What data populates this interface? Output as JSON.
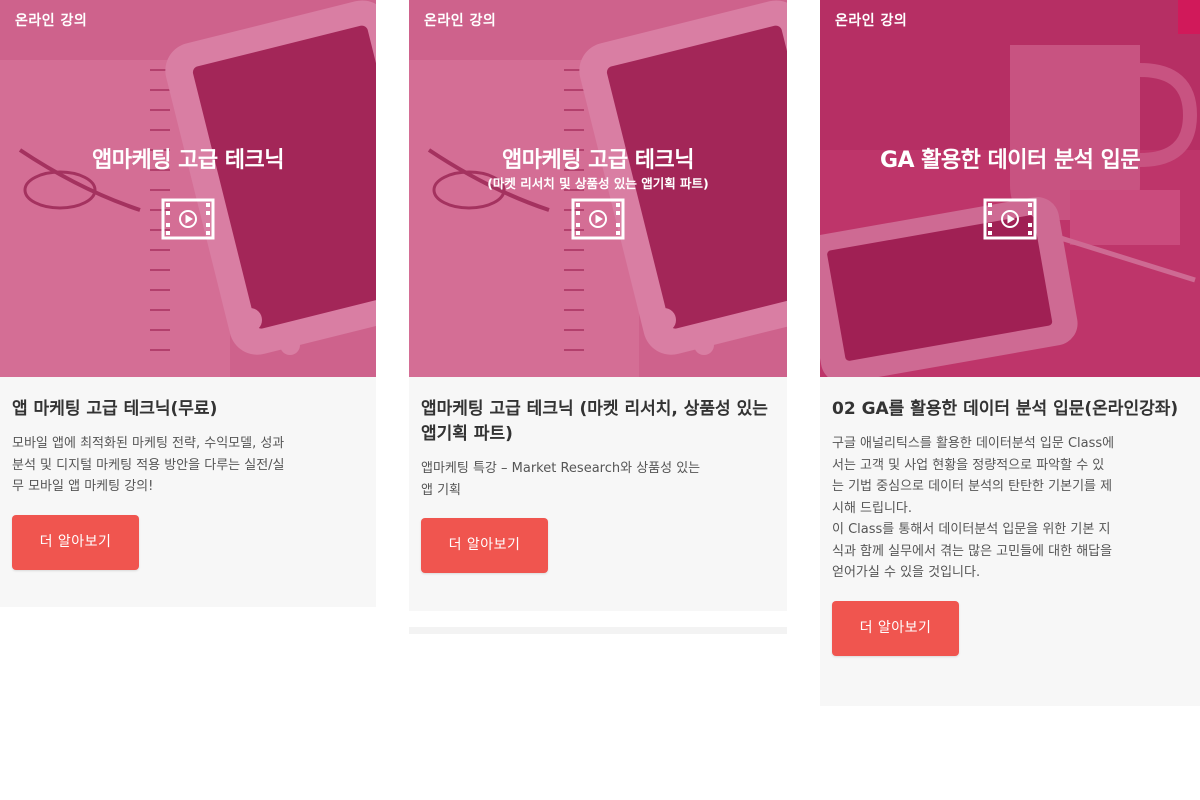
{
  "colors": {
    "accent": "#f0554f",
    "overlay": "#c4346e",
    "card_bg": "#f7f7f7"
  },
  "cards": [
    {
      "badge": "온라인 강의",
      "thumb_title": "앱마케팅 고급 테크닉",
      "title": "앱 마케팅 고급 테크닉(무료)",
      "description": [
        "모바일 앱에 최적화된 마케팅 전략, 수익모델, 성과",
        "분석 및 디지털 마케팅 적용 방안을 다루는 실전/실",
        "무 모바일 앱 마케팅 강의!"
      ],
      "button": "더 알아보기",
      "icon": "film-play-icon"
    },
    {
      "badge": "온라인 강의",
      "thumb_title": "앱마케팅 고급 테크닉",
      "thumb_subtitle": "(마켓 리서치 및 상품성 있는 앱기획 파트)",
      "title": "앱마케팅 고급 테크닉 (마켓 리서치, 상품성 있는 앱기획 파트)",
      "description": [
        "앱마케팅 특강 – Market Research와 상품성 있는",
        "앱 기획"
      ],
      "button": "더 알아보기",
      "icon": "film-play-icon"
    },
    {
      "badge": "온라인 강의",
      "thumb_title": "GA 활용한 데이터 분석 입문",
      "title": "02 GA를 활용한 데이터 분석 입문(온라인강좌)",
      "description": [
        "구글 애널리틱스를 활용한 데이터분석 입문 Class에",
        "서는 고객 및 사업 현황을 정량적으로 파악할 수 있",
        "는 기법 중심으로 데이터 분석의 탄탄한 기본기를 제",
        "시해 드립니다.",
        "이 Class를 통해서 데이터분석 입문을 위한 기본 지",
        "식과 함께 실무에서 겪는 많은 고민들에 대한 해답을",
        "얻어가실 수 있을 것입니다."
      ],
      "button": "더 알아보기",
      "icon": "film-play-icon"
    }
  ]
}
